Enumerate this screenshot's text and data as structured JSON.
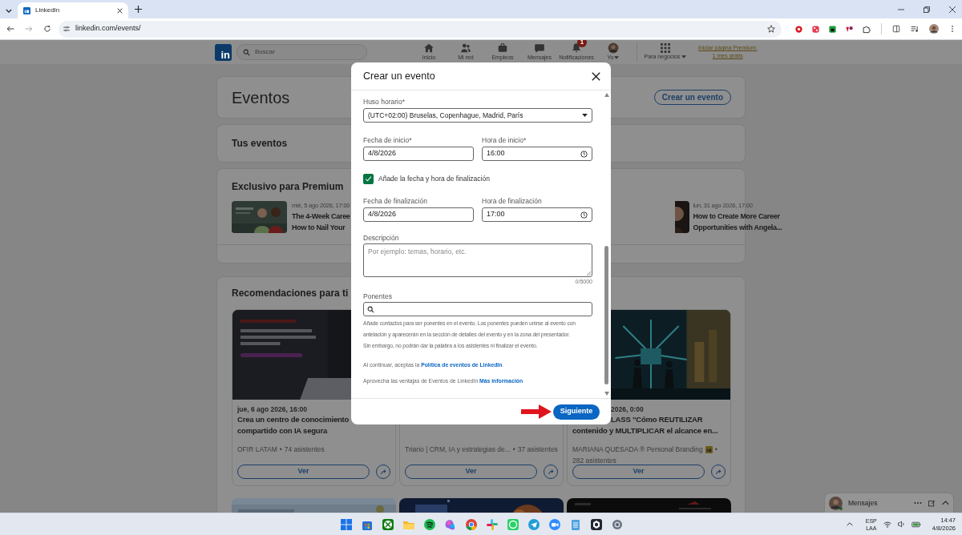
{
  "browser": {
    "tab_title": "LinkedIn",
    "url": "linkedin.com/events/"
  },
  "nav": {
    "logo": "in",
    "search_placeholder": "Buscar",
    "items": [
      {
        "label": "Inicio",
        "kind": "home"
      },
      {
        "label": "Mi red",
        "kind": "people"
      },
      {
        "label": "Empleos",
        "kind": "briefcase"
      },
      {
        "label": "Mensajes",
        "kind": "chat"
      },
      {
        "label": "Notificaciones",
        "kind": "bell",
        "badge": "1"
      },
      {
        "label": "Yo",
        "kind": "avatar"
      }
    ],
    "business": "Para negocios",
    "premium_lines": [
      "Iniciar página Premium:",
      "1 mes gratis"
    ]
  },
  "page": {
    "title": "Eventos",
    "create_button": "Crear un evento",
    "your_events": "Tus eventos",
    "premium": {
      "title": "Exclusivo para Premium",
      "events": [
        {
          "date": "mié, 5 ago 2026, 17:00",
          "title_lines": [
            "The 4-Week Caree",
            "How to Nail Your"
          ]
        },
        {
          "date": "lun, 31 ago 2026, 17:00",
          "title_lines": [
            "How to Create More Career",
            "Opportunities with Angela..."
          ]
        }
      ]
    },
    "recommendations": {
      "title": "Recomendaciones para ti",
      "cards": [
        {
          "date": "jue, 6 ago 2026, 16:00",
          "title_lines": [
            "Crea un centro de conocimiento",
            "compartido con IA segura"
          ],
          "organizer": "OFIR LATAM",
          "separator": "•",
          "attendees": "74 asistentes",
          "button": "Ver"
        },
        {
          "organizer": "Triario | CRM, IA y estrategias de...",
          "separator": "•",
          "attendees": "37 asistentes",
          "button": "Ver"
        },
        {
          "date": "2026, 0:00",
          "title_lines": [
            "LASS \"Cómo REUTILIZAR",
            "contenido y MULTIPLICAR el alcance en..."
          ],
          "organizer": "MARIANA QUESADA ® Personal Branding",
          "verified": true,
          "separator": "•",
          "attendees": "282 asistentes",
          "button": "Ver"
        }
      ]
    }
  },
  "modal": {
    "title": "Crear un evento",
    "timezone": {
      "label": "Huso horario*",
      "value": "(UTC+02:00) Bruselas, Copenhague, Madrid, París"
    },
    "start_date": {
      "label": "Fecha de inicio*",
      "value": "4/8/2026"
    },
    "start_time": {
      "label": "Hora de inicio*",
      "value": "16:00"
    },
    "end_toggle": {
      "label": "Añade la fecha y hora de finalización",
      "checked": true
    },
    "end_date": {
      "label": "Fecha de finalización",
      "value": "4/8/2026"
    },
    "end_time": {
      "label": "Hora de finalización",
      "value": "17:00"
    },
    "description": {
      "label": "Descripción",
      "placeholder": "Por ejemplo: temas, horario, etc.",
      "counter": "0/5000"
    },
    "speakers": {
      "label": "Ponentes",
      "help_lines": [
        "Añade contactos para ser ponentes en el evento. Los ponentes pueden unirse al evento con",
        "antelación y aparecerán en la sección de detalles del evento y en la zona del presentador.",
        "Sin embargo, no podrán dar la palabra a los asistentes ni finalizar el evento."
      ]
    },
    "policy": {
      "text": "Al continuar, aceptas la ",
      "link": "Política de eventos de LinkedIn",
      "end": "."
    },
    "promo": {
      "text": "Aprovecha las ventajas de Eventos de LinkedIn ",
      "link": "Más información"
    },
    "next_button": "Siguiente"
  },
  "messaging": {
    "label": "Mensajes"
  },
  "taskbar": {
    "language": [
      "ESP",
      "LAA"
    ],
    "time": "14:47",
    "date": "4/8/2026"
  }
}
